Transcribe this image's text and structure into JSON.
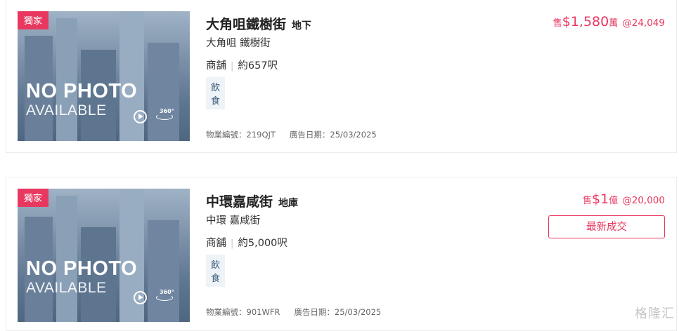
{
  "listings": [
    {
      "badge": "獨家",
      "photo_line1": "NO PHOTO",
      "photo_line2": "AVAILABLE",
      "vr_label": "360°",
      "title": "大角咀鐵樹街",
      "floor": "地下",
      "address": "大角咀 鐵樹街",
      "type": "商舖",
      "area": "約657呎",
      "tag": "飲食",
      "ref": "物業編號：219QJT",
      "date": "廣告日期：25/03/2025",
      "price_prefix": "售",
      "price_value": "$1,580",
      "price_unit": "萬",
      "price_per": "@24,049"
    },
    {
      "badge": "獨家",
      "photo_line1": "NO PHOTO",
      "photo_line2": "AVAILABLE",
      "vr_label": "360°",
      "title": "中環嘉咸街",
      "floor": "地庫",
      "address": "中環 嘉咸街",
      "type": "商舖",
      "area": "約5,000呎",
      "tag": "飲食",
      "ref": "物業編號：901WFR",
      "date": "廣告日期：25/03/2025",
      "price_prefix": "售",
      "price_value": "$1",
      "price_unit": "億",
      "price_per": "@20,000",
      "deal_button": "最新成交"
    }
  ],
  "watermark": "格隆汇",
  "colors": {
    "accent": "#e8385f",
    "tag_bg": "#eef3f8",
    "tag_text": "#3c5a7a"
  }
}
